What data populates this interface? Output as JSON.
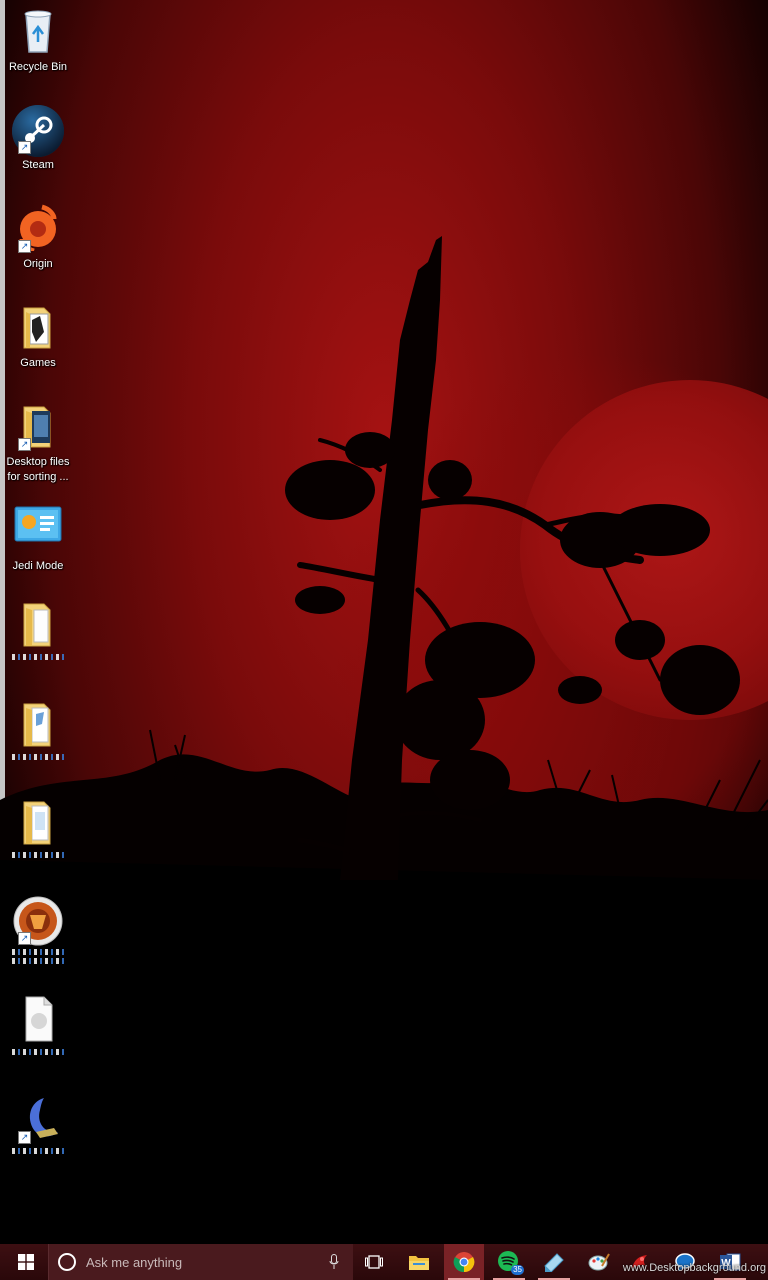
{
  "desktop": {
    "icons": [
      {
        "label": "Recycle Bin"
      },
      {
        "label": "Steam"
      },
      {
        "label": "Origin"
      },
      {
        "label": "Games"
      },
      {
        "label": "Desktop files for sorting ..."
      },
      {
        "label": "Jedi Mode"
      }
    ]
  },
  "taskbar": {
    "search_placeholder": "Ask me anything",
    "spotify_badge": "35",
    "watermark": "www.Desktopbackground.org"
  },
  "icons": {
    "start": "windows-logo-icon",
    "search": "cortana-ring-icon",
    "mic": "microphone-icon",
    "taskview": "task-view-icon",
    "explorer": "folder-icon",
    "chrome": "chrome-icon",
    "spotify": "spotify-icon",
    "sketch": "drawing-app-icon",
    "paint": "paint-palette-icon",
    "game": "red-game-icon",
    "chat": "chat-bubble-icon",
    "word": "word-icon"
  },
  "colors": {
    "taskbar": "#2a080a",
    "wallpaper_red": "#a51212",
    "active_app": "#7a2226"
  }
}
